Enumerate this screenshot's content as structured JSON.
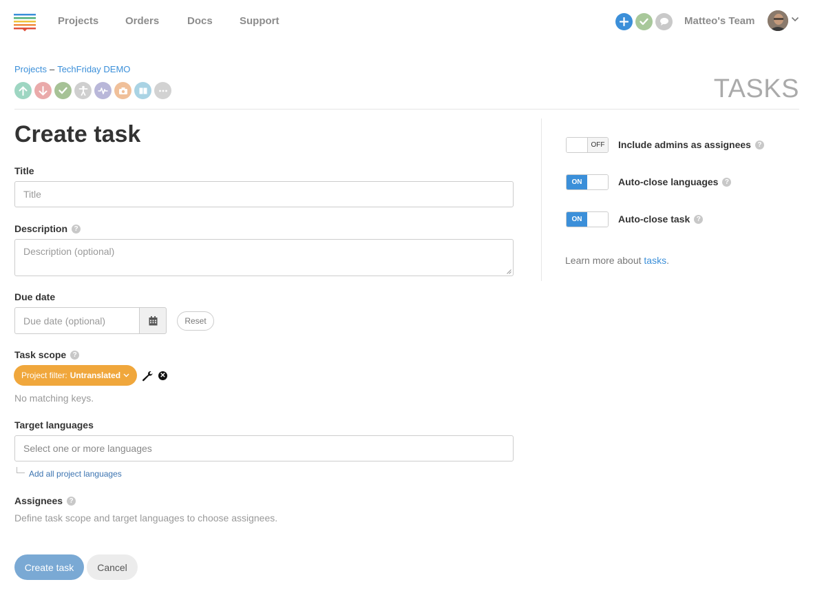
{
  "nav": {
    "links": [
      "Projects",
      "Orders",
      "Docs",
      "Support"
    ],
    "team_name": "Matteo's Team"
  },
  "breadcrumb": {
    "root": "Projects",
    "separator": "–",
    "project": "TechFriday DEMO"
  },
  "section_title": "TASKS",
  "form": {
    "page_title": "Create task",
    "title_label": "Title",
    "title_placeholder": "Title",
    "description_label": "Description",
    "description_placeholder": "Description (optional)",
    "due_date_label": "Due date",
    "due_date_placeholder": "Due date (optional)",
    "reset_label": "Reset",
    "task_scope_label": "Task scope",
    "filter_prefix": "Project filter:",
    "filter_value": "Untranslated",
    "no_matching": "No matching keys.",
    "target_languages_label": "Target languages",
    "target_languages_placeholder": "Select one or more languages",
    "add_all_languages": "Add all project languages",
    "assignees_label": "Assignees",
    "assignees_hint": "Define task scope and target languages to choose assignees.",
    "create_button": "Create task",
    "cancel_button": "Cancel"
  },
  "options": [
    {
      "label": "Include admins as assignees",
      "state": "OFF"
    },
    {
      "label": "Auto-close languages",
      "state": "ON"
    },
    {
      "label": "Auto-close task",
      "state": "ON"
    }
  ],
  "learn_more": {
    "prefix": "Learn more about",
    "link": "tasks",
    "suffix": "."
  },
  "colors": {
    "accent": "#3b8fd9",
    "filter_pill": "#f0a73c",
    "primary_button": "#7aa9d4"
  },
  "icons": {
    "top": [
      "plus-icon",
      "check-icon",
      "chat-icon"
    ],
    "project": [
      "upload-icon",
      "download-icon",
      "check-icon",
      "accessibility-icon",
      "activity-icon",
      "camera-icon",
      "book-icon",
      "more-icon"
    ]
  }
}
